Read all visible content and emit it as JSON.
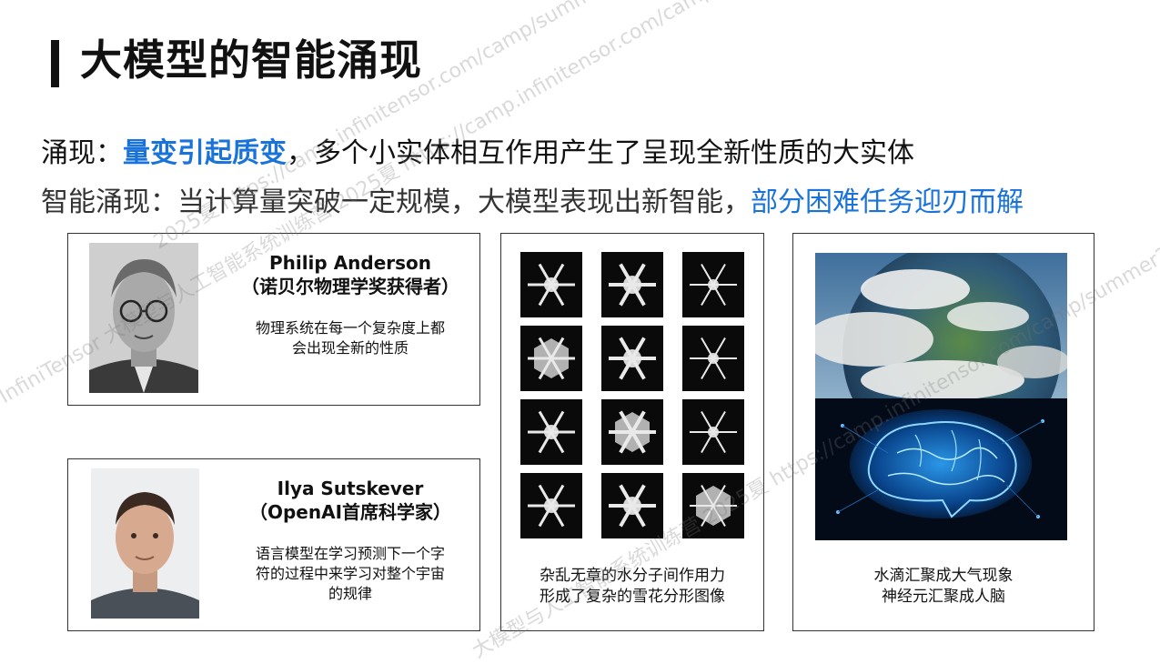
{
  "title": "大模型的智能涌现",
  "line1": {
    "prefix": "涌现：",
    "highlight": "量变引起质变",
    "rest": "，多个小实体相互作用产生了呈现全新性质的大实体"
  },
  "line2": {
    "prefix": "智能涌现：当计算量突破一定规模，大模型表现出新智能，",
    "highlight": "部分困难任务迎刃而解"
  },
  "anderson": {
    "name": "Philip Anderson",
    "role": "（诺贝尔物理学奖获得者）",
    "quote_line1": "物理系统在每一个复杂度上都",
    "quote_line2": "会出现全新的性质"
  },
  "sutskever": {
    "name": "Ilya Sutskever",
    "role": "（OpenAI首席科学家）",
    "quote_line1": "语言模型在学习预测下一个字",
    "quote_line2": "符的过程中来学习对整个宇宙",
    "quote_line3": "的规律"
  },
  "snowflakes": {
    "caption_line1": "杂乱无章的水分子间作用力",
    "caption_line2": "形成了复杂的雪花分形图像"
  },
  "earth_brain": {
    "caption_line1": "水滴汇聚成大气现象",
    "caption_line2": "神经元汇聚成人脑"
  },
  "watermarks": {
    "wm1": "2025夏 https://camp.infinitensor.com/camp/summer2025",
    "wm2": "InfiniTensor 大模型与人工智能系统训练营 2025夏 https://camp.infinitensor.com/camp/summer2025",
    "wm3": "大模型与人工智能系统训练营 2025夏 https://camp.infinitensor.com/camp/summer2025"
  },
  "colors": {
    "accent": "#1a73d9",
    "text": "#111111",
    "border": "#333333"
  }
}
